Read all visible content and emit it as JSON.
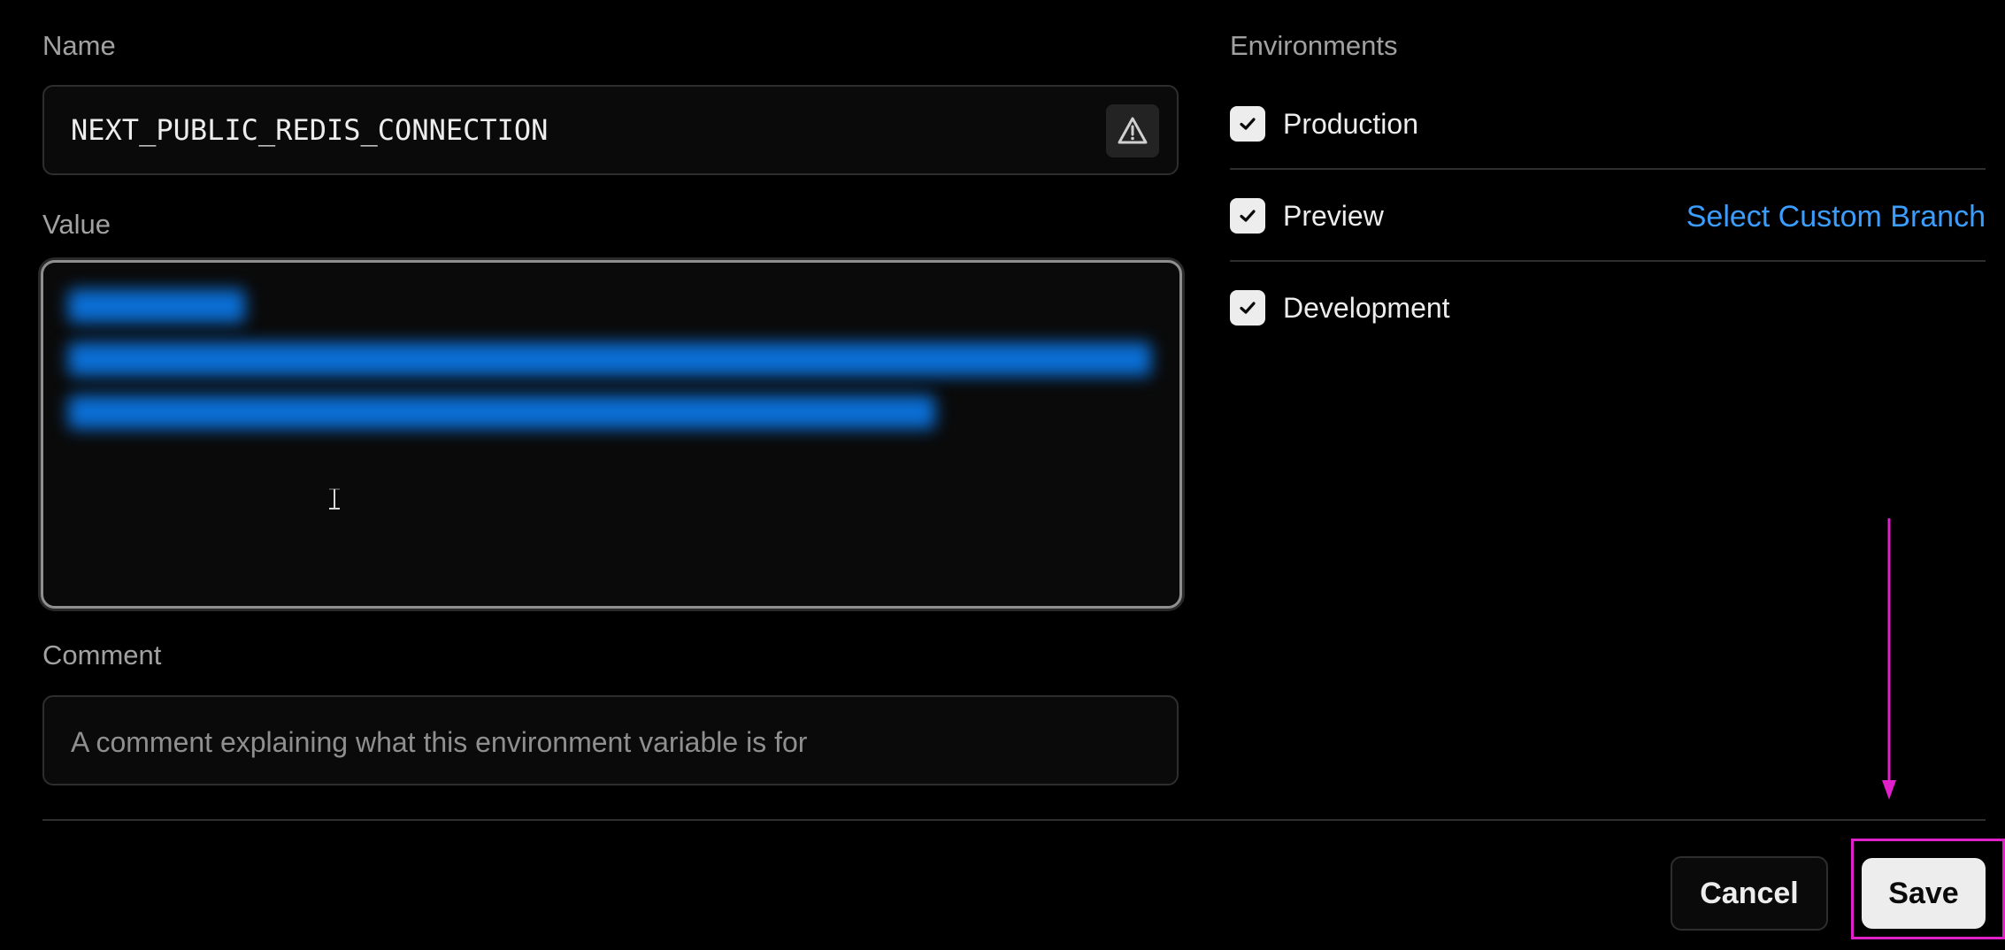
{
  "form": {
    "name_label": "Name",
    "name_value": "NEXT_PUBLIC_REDIS_CONNECTION",
    "value_label": "Value",
    "comment_label": "Comment",
    "comment_placeholder": "A comment explaining what this environment variable is for"
  },
  "environments": {
    "label": "Environments",
    "items": [
      {
        "label": "Production",
        "checked": true
      },
      {
        "label": "Preview",
        "checked": true
      },
      {
        "label": "Development",
        "checked": true
      }
    ],
    "custom_branch_link": "Select Custom Branch"
  },
  "actions": {
    "cancel_label": "Cancel",
    "save_label": "Save"
  },
  "colors": {
    "accent_link": "#3b9eff",
    "annotation": "#e020c8",
    "redacted_value": "#0b6fd6"
  },
  "icons": {
    "warning": "warning-triangle-icon",
    "checkbox": "checkmark-icon",
    "cursor": "text-cursor-icon",
    "annotation_arrow": "arrow-down-icon"
  }
}
